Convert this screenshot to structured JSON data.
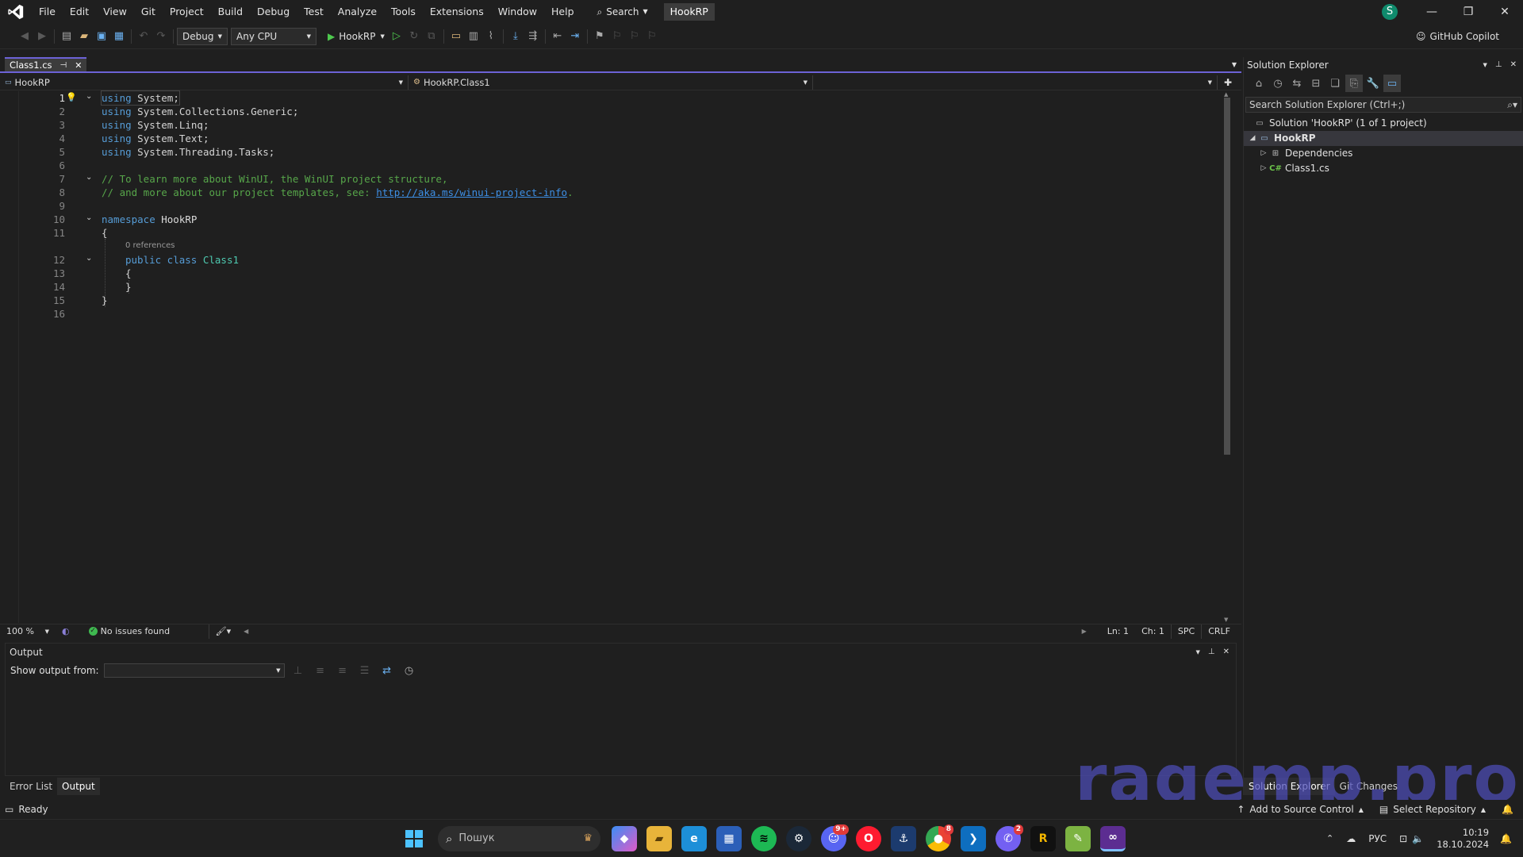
{
  "menu": {
    "items": [
      "File",
      "Edit",
      "View",
      "Git",
      "Project",
      "Build",
      "Debug",
      "Test",
      "Analyze",
      "Tools",
      "Extensions",
      "Window",
      "Help"
    ],
    "search_label": "Search",
    "solution_name": "HookRP",
    "avatar_letter": "S"
  },
  "toolbar": {
    "configuration": "Debug",
    "platform": "Any CPU",
    "run_target": "HookRP",
    "copilot": "GitHub Copilot"
  },
  "editor": {
    "tab_label": "Class1.cs",
    "nav_project": "HookRP",
    "nav_class": "HookRP.Class1",
    "codelens": "0 references",
    "lines": {
      "l1": {
        "kw": "using",
        "rest": " System;"
      },
      "l2": {
        "kw": "using",
        "rest": " System.Collections.Generic;"
      },
      "l3": {
        "kw": "using",
        "rest": " System.Linq;"
      },
      "l4": {
        "kw": "using",
        "rest": " System.Text;"
      },
      "l5": {
        "kw": "using",
        "rest": " System.Threading.Tasks;"
      },
      "l7": {
        "comment": "// To learn more about WinUI, the WinUI project structure,"
      },
      "l8": {
        "comment": "// and more about our project templates, see: ",
        "link": "http://aka.ms/winui-project-info",
        "tail": "."
      },
      "l10": {
        "kw": "namespace",
        "name": " HookRP"
      },
      "l11": {
        "text": "{"
      },
      "l12": {
        "kw1": "public",
        "kw2": " class",
        "cls": " Class1"
      },
      "l13": {
        "text": "{"
      },
      "l14": {
        "text": "}"
      },
      "l15": {
        "text": "}"
      }
    },
    "line_numbers": [
      "1",
      "2",
      "3",
      "4",
      "5",
      "6",
      "7",
      "8",
      "9",
      "10",
      "11",
      "12",
      "13",
      "14",
      "15",
      "16"
    ]
  },
  "editor_status": {
    "zoom": "100 %",
    "issues": "No issues found",
    "ln": "Ln: 1",
    "ch": "Ch: 1",
    "spc": "SPC",
    "eol": "CRLF"
  },
  "output": {
    "title": "Output",
    "show_from_label": "Show output from:"
  },
  "bottom_tabs": [
    "Error List",
    "Output"
  ],
  "solution_explorer": {
    "title": "Solution Explorer",
    "search_placeholder": "Search Solution Explorer (Ctrl+;)",
    "solution_node": "Solution 'HookRP' (1 of 1 project)",
    "project_node": "HookRP",
    "dependencies": "Dependencies",
    "file": "Class1.cs",
    "tabs": [
      "Solution Explorer",
      "Git Changes"
    ]
  },
  "statusbar": {
    "ready": "Ready",
    "add_source": "Add to Source Control",
    "select_repo": "Select Repository"
  },
  "taskbar": {
    "search": "Пошук",
    "lang": "РУС",
    "time": "10:19",
    "date": "18.10.2024"
  },
  "watermark": "ragemp.pro"
}
